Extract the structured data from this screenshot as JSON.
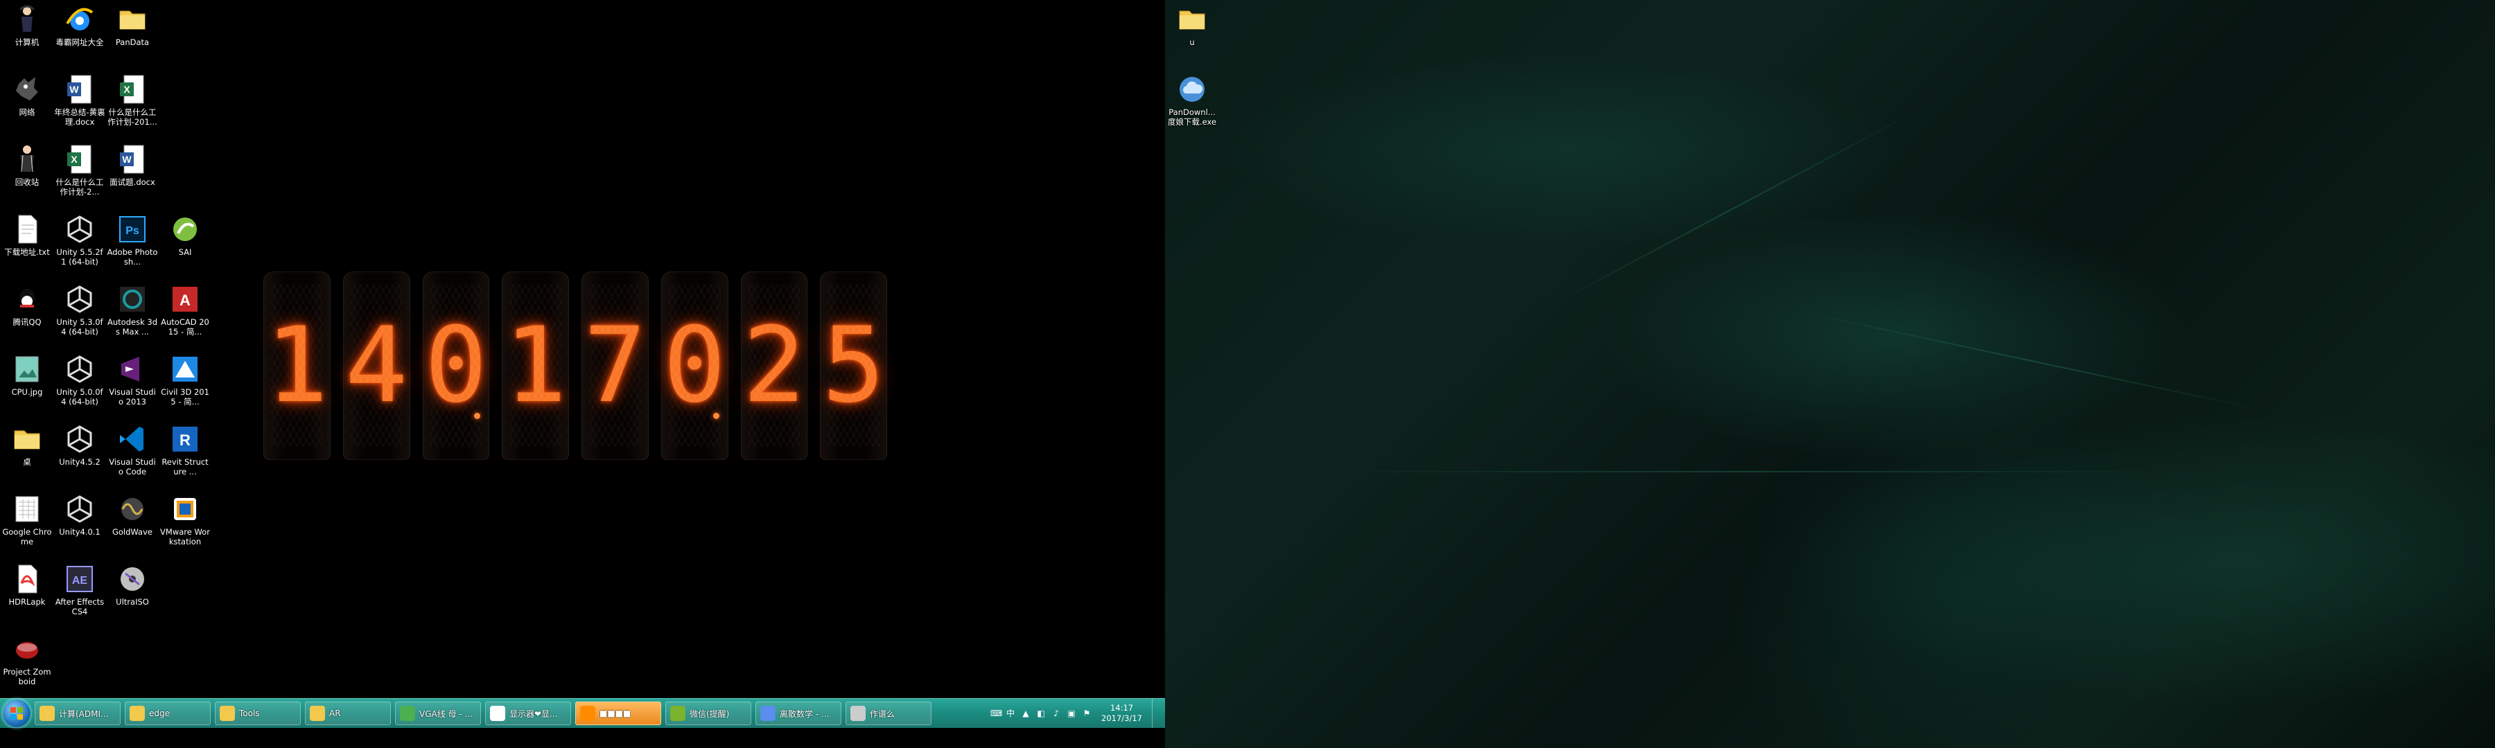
{
  "desktop_left": {
    "icons": [
      {
        "label": "计算机",
        "icon": "computer-icon",
        "color": "#6fa8dc"
      },
      {
        "label": "毒霸网址大全",
        "icon": "ie-icon",
        "color": "#1e90ff"
      },
      {
        "label": "PanData",
        "icon": "folder-icon",
        "color": "#f2c94c"
      },
      {
        "label": "网络",
        "icon": "network-icon",
        "color": "#888888"
      },
      {
        "label": "年终总结-黄裏理.docx",
        "icon": "word-icon",
        "color": "#2b579a"
      },
      {
        "label": "什么是什么工作计划-201...",
        "icon": "excel-icon",
        "color": "#217346"
      },
      {
        "label": "回收站",
        "icon": "recycle-bin-icon",
        "color": "#b0b0b0"
      },
      {
        "label": "什么是什么工作计划-2...",
        "icon": "excel-icon",
        "color": "#217346"
      },
      {
        "label": "面试题.docx",
        "icon": "word-icon",
        "color": "#2b579a"
      },
      {
        "label": "下载地址.txt",
        "icon": "text-file-icon",
        "color": "#ffffff"
      },
      {
        "label": "Unity 5.5.2f1 (64-bit)",
        "icon": "unity-icon",
        "color": "#dddddd"
      },
      {
        "label": "Adobe Photosh...",
        "icon": "photoshop-icon",
        "color": "#31a8ff"
      },
      {
        "label": "SAI",
        "icon": "sai-icon",
        "color": "#7fbf3f"
      },
      {
        "label": "腾讯QQ",
        "icon": "qq-icon",
        "color": "#d32f2f"
      },
      {
        "label": "Unity 5.3.0f4 (64-bit)",
        "icon": "unity-icon",
        "color": "#dddddd"
      },
      {
        "label": "Autodesk 3ds Max ...",
        "icon": "3dsmax-icon",
        "color": "#1b9aa0"
      },
      {
        "label": "AutoCAD 2015 - 简...",
        "icon": "autocad-icon",
        "color": "#c62828"
      },
      {
        "label": "CPU.jpg",
        "icon": "image-file-icon",
        "color": "#7fd0c0"
      },
      {
        "label": "Unity 5.0.0f4 (64-bit)",
        "icon": "unity-icon",
        "color": "#dddddd"
      },
      {
        "label": "Visual Studio 2013",
        "icon": "visual-studio-icon",
        "color": "#68217a"
      },
      {
        "label": "Civil 3D 2015 - 简...",
        "icon": "civil3d-icon",
        "color": "#1e88e5"
      },
      {
        "label": "桌",
        "icon": "folder-icon",
        "color": "#f2c94c"
      },
      {
        "label": "Unity4.5.2",
        "icon": "unity-icon",
        "color": "#dddddd"
      },
      {
        "label": "Visual Studio Code",
        "icon": "vscode-icon",
        "color": "#007acc"
      },
      {
        "label": "Revit Structure ...",
        "icon": "revit-icon",
        "color": "#1565c0"
      },
      {
        "label": "Google Chrome",
        "icon": "chrome-doc-icon",
        "color": "#ffffff"
      },
      {
        "label": "Unity4.0.1",
        "icon": "unity-icon",
        "color": "#dddddd"
      },
      {
        "label": "GoldWave",
        "icon": "goldwave-icon",
        "color": "#d4b24c"
      },
      {
        "label": "VMware Workstation",
        "icon": "vmware-icon",
        "color": "#f39c12"
      },
      {
        "label": "HDRLapk",
        "icon": "pdf-icon",
        "color": "#e53935"
      },
      {
        "label": "After Effects CS4",
        "icon": "after-effects-icon",
        "color": "#9999ff"
      },
      {
        "label": "UltraISO",
        "icon": "ultraiso-icon",
        "color": "#c0c0c0"
      },
      {
        "label": "Project Zomboid",
        "icon": "project-zomboid-icon",
        "color": "#b71c1c"
      }
    ]
  },
  "nixie_clock": {
    "digits": [
      "1",
      "4",
      "0",
      "1",
      "7",
      "0",
      "2",
      "5"
    ],
    "decimal_points": [
      false,
      false,
      true,
      false,
      false,
      true,
      false,
      false
    ],
    "glow_color": "#ff7a2a"
  },
  "desktop_right": {
    "icons": [
      {
        "label": "u",
        "icon": "folder-icon",
        "color": "#f2c94c"
      },
      {
        "label": "PanDownl...度娘下载.exe",
        "icon": "cloud-icon",
        "color": "#cfe8ff"
      }
    ]
  },
  "taskbar": {
    "start_label": "Start",
    "tasks": [
      {
        "label": "计算(ADMI...",
        "icon": "folder-icon",
        "color": "#f2c94c",
        "active": false
      },
      {
        "label": "edge",
        "icon": "folder-icon",
        "color": "#f2c94c",
        "active": false
      },
      {
        "label": "Tools",
        "icon": "folder-icon",
        "color": "#f2c94c",
        "active": false
      },
      {
        "label": "AR",
        "icon": "folder-icon",
        "color": "#f2c94c",
        "active": false
      },
      {
        "label": "VGA线 母 - ...",
        "icon": "chrome-icon",
        "color": "#4caf50",
        "active": false
      },
      {
        "label": "显示器❤显...",
        "icon": "qq-chat-icon",
        "color": "#ffffff",
        "active": false
      },
      {
        "label": "■■■■",
        "icon": "app-icon",
        "color": "#ff8c00",
        "active": true
      },
      {
        "label": "微信(提醒)",
        "icon": "wechat-icon",
        "color": "#7bb32e",
        "active": false
      },
      {
        "label": "离散数学 - ...",
        "icon": "document-icon",
        "color": "#5a8dee",
        "active": false
      },
      {
        "label": "作谱么",
        "icon": "settings-icon",
        "color": "#cccccc",
        "active": false
      }
    ],
    "tray": {
      "icons": [
        "keyboard-icon",
        "input-method-icon",
        "arrow-up-icon",
        "network-tray-icon",
        "volume-icon",
        "notification-icon",
        "flag-icon"
      ],
      "time": "14:17",
      "date": "2017/3/17"
    }
  }
}
